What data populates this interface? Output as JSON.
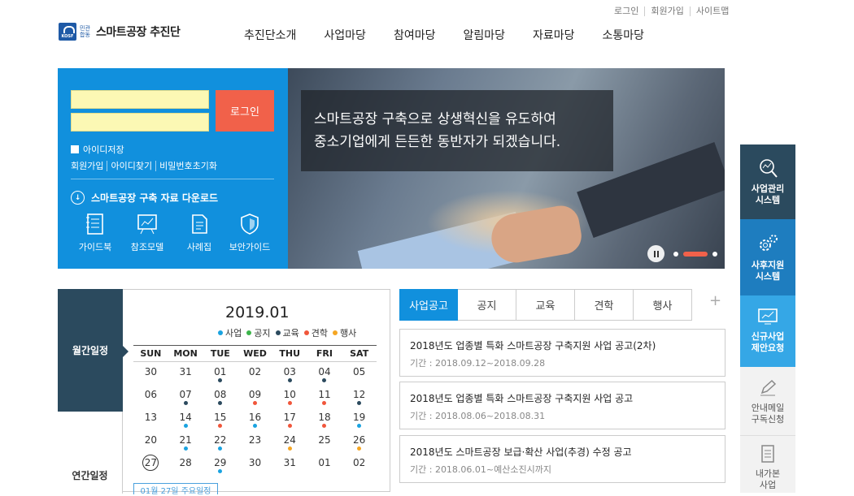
{
  "util": {
    "login": "로그인",
    "join": "회원가입",
    "sitemap": "사이트맵"
  },
  "logo": {
    "badge": "KOSF",
    "org": "민관합동",
    "name": "스마트공장 추진단"
  },
  "gnb": [
    "추진단소개",
    "사업마당",
    "참여마당",
    "알림마당",
    "자료마당",
    "소통마당"
  ],
  "login": {
    "button": "로그인",
    "save_id": "아이디저장",
    "links": [
      "회원가입",
      "아이디찾기",
      "비밀번호초기화"
    ],
    "download": "스마트공장 구축 자료 다운로드",
    "quick": [
      "가이드북",
      "참조모델",
      "사례집",
      "보안가이드"
    ]
  },
  "banner": {
    "line1": "스마트공장 구축으로 상생혁신을 유도하여",
    "line2": "중소기업에게 든든한 동반자가 되겠습니다."
  },
  "schedule": {
    "tab_month": "월간일정",
    "tab_year": "연간일정",
    "title": "2019.01",
    "today_label": "01월 27일 주요일정",
    "legend": [
      {
        "label": "사업",
        "color": "#1aa3e0"
      },
      {
        "label": "공지",
        "color": "#3cb44a"
      },
      {
        "label": "교육",
        "color": "#2b4a5e"
      },
      {
        "label": "견학",
        "color": "#f0563b"
      },
      {
        "label": "행사",
        "color": "#f5a623"
      }
    ],
    "weekdays": [
      "SUN",
      "MON",
      "TUE",
      "WED",
      "THU",
      "FRI",
      "SAT"
    ],
    "weeks": [
      [
        {
          "d": "30"
        },
        {
          "d": "31"
        },
        {
          "d": "01",
          "c": "#2b4a5e"
        },
        {
          "d": "02"
        },
        {
          "d": "03",
          "c": "#2b4a5e"
        },
        {
          "d": "04",
          "c": "#2b4a5e"
        },
        {
          "d": "05"
        }
      ],
      [
        {
          "d": "06"
        },
        {
          "d": "07",
          "c": "#2b4a5e"
        },
        {
          "d": "08",
          "c": "#2b4a5e"
        },
        {
          "d": "09",
          "c": "#f0563b"
        },
        {
          "d": "10",
          "c": "#f0563b"
        },
        {
          "d": "11",
          "c": "#f0563b"
        },
        {
          "d": "12",
          "c": "#2b4a5e"
        }
      ],
      [
        {
          "d": "13"
        },
        {
          "d": "14",
          "c": "#1aa3e0"
        },
        {
          "d": "15",
          "c": "#f0563b"
        },
        {
          "d": "16",
          "c": "#1aa3e0"
        },
        {
          "d": "17",
          "c": "#f0563b"
        },
        {
          "d": "18",
          "c": "#f0563b"
        },
        {
          "d": "19",
          "c": "#1aa3e0"
        }
      ],
      [
        {
          "d": "20"
        },
        {
          "d": "21",
          "c": "#1aa3e0"
        },
        {
          "d": "22",
          "c": "#1aa3e0"
        },
        {
          "d": "23"
        },
        {
          "d": "24",
          "c": "#f5a623"
        },
        {
          "d": "25"
        },
        {
          "d": "26",
          "c": "#f5a623"
        }
      ],
      [
        {
          "d": "27",
          "today": true
        },
        {
          "d": "28"
        },
        {
          "d": "29",
          "c": "#1aa3e0"
        },
        {
          "d": "30"
        },
        {
          "d": "31"
        },
        {
          "d": "01"
        },
        {
          "d": "02"
        }
      ]
    ]
  },
  "notice": {
    "tabs": [
      "사업공고",
      "공지",
      "교육",
      "견학",
      "행사"
    ],
    "more": "+",
    "items": [
      {
        "title": "2018년도 업종별 특화 스마트공장 구축지원 사업 공고(2차)",
        "date": "기간 : 2018.09.12~2018.09.28"
      },
      {
        "title": "2018년도 업종별 특화 스마트공장 구축지원 사업 공고",
        "date": "기간 : 2018.08.06~2018.08.31"
      },
      {
        "title": "2018년도 스마트공장 보급·확산 사업(추경) 수정 공고",
        "date": "기간 : 2018.06.01~예산소진시까지"
      }
    ]
  },
  "quickmenu": [
    {
      "l1": "사업관리",
      "l2": "시스템",
      "bg": "#2b4a5e"
    },
    {
      "l1": "사후지원",
      "l2": "시스템",
      "bg": "#1e7dbf"
    },
    {
      "l1": "신규사업",
      "l2": "제안요청",
      "bg": "#35a7e6"
    },
    {
      "l1": "안내메일",
      "l2": "구독신청",
      "bg": "#f2f2f2"
    },
    {
      "l1": "내가본",
      "l2": "사업",
      "bg": "#f2f2f2"
    }
  ]
}
